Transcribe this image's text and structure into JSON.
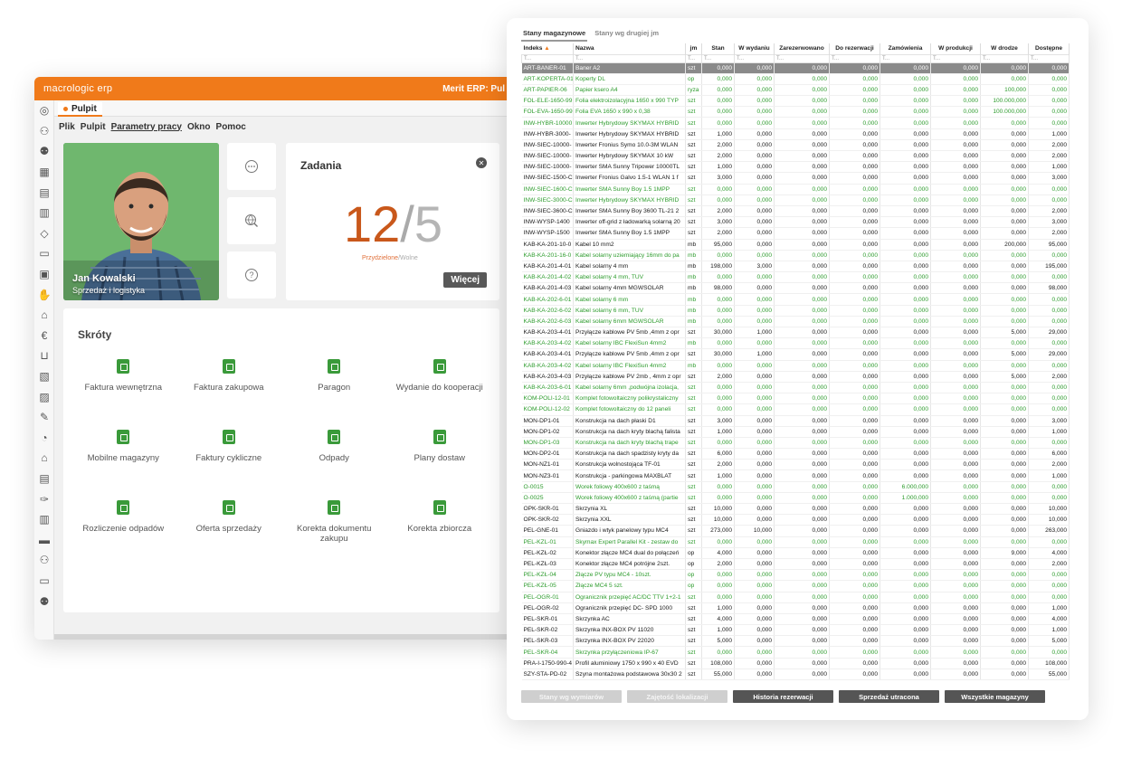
{
  "left_window": {
    "app_name": "macrologic erp",
    "system_title": "Merit ERP: Pul",
    "tab_label": "Pulpit",
    "menu": [
      "Plik",
      "Pulpit",
      "Parametry pracy",
      "Okno",
      "Pomoc"
    ],
    "sidebar_icons": [
      "network-icon",
      "people-icon",
      "user-icon",
      "calculator-grid-icon",
      "document-icon",
      "table-icon",
      "diamond-icon",
      "card-icon",
      "clipboard-icon",
      "handshake-icon",
      "bank-icon",
      "euro-icon",
      "basket-icon",
      "documents-icon",
      "factory-icon",
      "tools-icon",
      "bag-icon",
      "warehouse-icon",
      "invoice-icon",
      "wrench-icon",
      "trash-icon",
      "truck-icon",
      "person-icon",
      "wallet-icon",
      "user-settings-icon"
    ],
    "profile": {
      "name": "Jan Kowalski",
      "role": "Sprzedaż i logistyka"
    },
    "tasks": {
      "title": "Zadania",
      "assigned": "12",
      "separator": "/",
      "free": "5",
      "caption_assigned": "Przydzielone",
      "caption_sep": "/",
      "caption_free": "Wolne",
      "more_label": "Więcej"
    },
    "shortcuts": {
      "title": "Skróty",
      "items": [
        {
          "label": "Faktura wewnętrzna"
        },
        {
          "label": "Faktura zakupowa"
        },
        {
          "label": "Paragon"
        },
        {
          "label": "Wydanie do kooperacji"
        },
        {
          "label": "Mobilne magazyny"
        },
        {
          "label": "Faktury cykliczne"
        },
        {
          "label": "Odpady"
        },
        {
          "label": "Plany dostaw"
        },
        {
          "label": "Rozliczenie odpadów"
        },
        {
          "label": "Oferta sprzedaży"
        },
        {
          "label": "Korekta dokumentu zakupu"
        },
        {
          "label": "Korekta zbiorcza"
        }
      ]
    },
    "accent": "#f07a1a"
  },
  "right_window": {
    "tabs": [
      "Stany magazynowe",
      "Stany wg drugiej jm"
    ],
    "columns": [
      "Indeks",
      "Nazwa",
      "jm",
      "Stan",
      "W wydaniu",
      "Zarezerwowano",
      "Do rezerwacji",
      "Zamówienia",
      "W produkcji",
      "W drodze",
      "Dostępne"
    ],
    "filter_placeholder": "T...",
    "rows": [
      {
        "c": "s",
        "v": [
          "ART-BANER-01",
          "Baner A2",
          "szt",
          "0,000",
          "0,000",
          "0,000",
          "0,000",
          "0,000",
          "0,000",
          "0,000",
          "0,000"
        ]
      },
      {
        "c": "g",
        "v": [
          "ART-KOPERTA-01",
          "Koperty DL",
          "op",
          "0,000",
          "0,000",
          "0,000",
          "0,000",
          "0,000",
          "0,000",
          "0,000",
          "0,000"
        ]
      },
      {
        "c": "g",
        "v": [
          "ART-PAPIER-06",
          "Papier ksero A4",
          "ryza",
          "0,000",
          "0,000",
          "0,000",
          "0,000",
          "0,000",
          "0,000",
          "100,000",
          "0,000"
        ]
      },
      {
        "c": "g",
        "v": [
          "FOL-ELE-1650-99",
          "Folia elektroizolacyjna 1650 x 990  TYP",
          "szt",
          "0,000",
          "0,000",
          "0,000",
          "0,000",
          "0,000",
          "0,000",
          "100.000,000",
          "0,000"
        ]
      },
      {
        "c": "g",
        "v": [
          "FOL-EVA-1650-99",
          "Folia EVA 1650 x 990 x 0,38",
          "szt",
          "0,000",
          "0,000",
          "0,000",
          "0,000",
          "0,000",
          "0,000",
          "100.000,000",
          "0,000"
        ]
      },
      {
        "c": "g",
        "v": [
          "INW-HYBR-10000",
          "Inwerter Hybrydowy SKYMAX HYBRID",
          "szt",
          "0,000",
          "0,000",
          "0,000",
          "0,000",
          "0,000",
          "0,000",
          "0,000",
          "0,000"
        ]
      },
      {
        "c": "b",
        "v": [
          "INW-HYBR-3000-",
          "Inwerter Hybrydowy SKYMAX HYBRID",
          "szt",
          "1,000",
          "0,000",
          "0,000",
          "0,000",
          "0,000",
          "0,000",
          "0,000",
          "1,000"
        ]
      },
      {
        "c": "b",
        "v": [
          "INW-SIEC-10000-",
          "Inwerter Fronius Symo 10.0-3M WLAN",
          "szt",
          "2,000",
          "0,000",
          "0,000",
          "0,000",
          "0,000",
          "0,000",
          "0,000",
          "2,000"
        ]
      },
      {
        "c": "b",
        "v": [
          "INW-SIEC-10000-",
          "Inwerter Hybrydowy SKYMAX 10 kW",
          "szt",
          "2,000",
          "0,000",
          "0,000",
          "0,000",
          "0,000",
          "0,000",
          "0,000",
          "2,000"
        ]
      },
      {
        "c": "b",
        "v": [
          "INW-SIEC-10000-",
          "Inwerter SMA Sunny Tripower 10000TL",
          "szt",
          "1,000",
          "0,000",
          "0,000",
          "0,000",
          "0,000",
          "0,000",
          "0,000",
          "1,000"
        ]
      },
      {
        "c": "b",
        "v": [
          "INW-SIEC-1500-C",
          "Inwerter Fronius Galvo 1.5-1 WLAN 1 f",
          "szt",
          "3,000",
          "0,000",
          "0,000",
          "0,000",
          "0,000",
          "0,000",
          "0,000",
          "3,000"
        ]
      },
      {
        "c": "g",
        "v": [
          "INW-SIEC-1600-C",
          "Inwerter SMA Sunny Boy 1.5 1MPP",
          "szt",
          "0,000",
          "0,000",
          "0,000",
          "0,000",
          "0,000",
          "0,000",
          "0,000",
          "0,000"
        ]
      },
      {
        "c": "g",
        "v": [
          "INW-SIEC-3000-C",
          "Inwerter Hybrydowy SKYMAX HYBRID",
          "szt",
          "0,000",
          "0,000",
          "0,000",
          "0,000",
          "0,000",
          "0,000",
          "0,000",
          "0,000"
        ]
      },
      {
        "c": "b",
        "v": [
          "INW-SIEC-3600-C",
          "Inwerter SMA Sunny Boy 3600 TL-21 2",
          "szt",
          "2,000",
          "0,000",
          "0,000",
          "0,000",
          "0,000",
          "0,000",
          "0,000",
          "2,000"
        ]
      },
      {
        "c": "b",
        "v": [
          "INW-WYSP-1400",
          "Inwerter off-grid z ładowarką solarną 20",
          "szt",
          "3,000",
          "0,000",
          "0,000",
          "0,000",
          "0,000",
          "0,000",
          "0,000",
          "3,000"
        ]
      },
      {
        "c": "b",
        "v": [
          "INW-WYSP-1500",
          "Inwerter SMA Sunny Boy 1.5 1MPP",
          "szt",
          "2,000",
          "0,000",
          "0,000",
          "0,000",
          "0,000",
          "0,000",
          "0,000",
          "2,000"
        ]
      },
      {
        "c": "b",
        "v": [
          "KAB-KA-201-10-0",
          "Kabel 10 mm2",
          "mb",
          "95,000",
          "0,000",
          "0,000",
          "0,000",
          "0,000",
          "0,000",
          "200,000",
          "95,000"
        ]
      },
      {
        "c": "g",
        "v": [
          "KAB-KA-201-16-0",
          "Kabel solarny uziemiający 16mm do pa",
          "mb",
          "0,000",
          "0,000",
          "0,000",
          "0,000",
          "0,000",
          "0,000",
          "0,000",
          "0,000"
        ]
      },
      {
        "c": "b",
        "v": [
          "KAB-KA-201-4-01",
          "Kabel solarny 4 mm",
          "mb",
          "198,000",
          "3,000",
          "0,000",
          "0,000",
          "0,000",
          "0,000",
          "0,000",
          "195,000"
        ]
      },
      {
        "c": "g",
        "v": [
          "KAB-KA-201-4-02",
          "Kabel solarny 4 mm, TUV",
          "mb",
          "0,000",
          "0,000",
          "0,000",
          "0,000",
          "0,000",
          "0,000",
          "0,000",
          "0,000"
        ]
      },
      {
        "c": "b",
        "v": [
          "KAB-KA-201-4-03",
          "Kabel solarny 4mm MGWSOLAR",
          "mb",
          "98,000",
          "0,000",
          "0,000",
          "0,000",
          "0,000",
          "0,000",
          "0,000",
          "98,000"
        ]
      },
      {
        "c": "g",
        "v": [
          "KAB-KA-202-6-01",
          "Kabel solarny 6 mm",
          "mb",
          "0,000",
          "0,000",
          "0,000",
          "0,000",
          "0,000",
          "0,000",
          "0,000",
          "0,000"
        ]
      },
      {
        "c": "g",
        "v": [
          "KAB-KA-202-6-02",
          "Kabel solarny 6 mm, TUV",
          "mb",
          "0,000",
          "0,000",
          "0,000",
          "0,000",
          "0,000",
          "0,000",
          "0,000",
          "0,000"
        ]
      },
      {
        "c": "g",
        "v": [
          "KAB-KA-202-6-03",
          "Kabel solarny 6mm MGWSOLAR",
          "mb",
          "0,000",
          "0,000",
          "0,000",
          "0,000",
          "0,000",
          "0,000",
          "0,000",
          "0,000"
        ]
      },
      {
        "c": "b",
        "v": [
          "KAB-KA-203-4-01",
          "Przyłącze kablowe PV 5mb ,4mm z opr",
          "szt",
          "30,000",
          "1,000",
          "0,000",
          "0,000",
          "0,000",
          "0,000",
          "5,000",
          "29,000"
        ]
      },
      {
        "c": "g",
        "v": [
          "KAB-KA-203-4-02",
          "Kabel solarny IBC FlexiSun 4mm2",
          "mb",
          "0,000",
          "0,000",
          "0,000",
          "0,000",
          "0,000",
          "0,000",
          "0,000",
          "0,000"
        ]
      },
      {
        "c": "b",
        "v": [
          "KAB-KA-203-4-01",
          "Przyłącze kablowe PV 5mb ,4mm z opr",
          "szt",
          "30,000",
          "1,000",
          "0,000",
          "0,000",
          "0,000",
          "0,000",
          "5,000",
          "29,000"
        ]
      },
      {
        "c": "g",
        "v": [
          "KAB-KA-203-4-02",
          "Kabel solarny IBC FlexiSun 4mm2",
          "mb",
          "0,000",
          "0,000",
          "0,000",
          "0,000",
          "0,000",
          "0,000",
          "0,000",
          "0,000"
        ]
      },
      {
        "c": "b",
        "v": [
          "KAB-KA-203-4-03",
          "Przyłącze kablowe PV 2mb , 4mm z opr",
          "szt",
          "2,000",
          "0,000",
          "0,000",
          "0,000",
          "0,000",
          "0,000",
          "5,000",
          "2,000"
        ]
      },
      {
        "c": "g",
        "v": [
          "KAB-KA-203-6-01",
          "Kabel solarny 6mm ,podwójna izolacja,",
          "szt",
          "0,000",
          "0,000",
          "0,000",
          "0,000",
          "0,000",
          "0,000",
          "0,000",
          "0,000"
        ]
      },
      {
        "c": "g",
        "v": [
          "KOM-POLI-12-01",
          "Komplet fotowoltaiczny polikrystaliczny",
          "szt",
          "0,000",
          "0,000",
          "0,000",
          "0,000",
          "0,000",
          "0,000",
          "0,000",
          "0,000"
        ]
      },
      {
        "c": "g",
        "v": [
          "KOM-POLI-12-02",
          "Komplet fotowoltaiczny do 12 paneli",
          "szt",
          "0,000",
          "0,000",
          "0,000",
          "0,000",
          "0,000",
          "0,000",
          "0,000",
          "0,000"
        ]
      },
      {
        "c": "b",
        "v": [
          "MON-DP1-01",
          "Konstrukcja na dach płaski D1",
          "szt",
          "3,000",
          "0,000",
          "0,000",
          "0,000",
          "0,000",
          "0,000",
          "0,000",
          "3,000"
        ]
      },
      {
        "c": "b",
        "v": [
          "MON-DP1-02",
          "Konstrukcja na dach kryty blachą falista",
          "szt",
          "1,000",
          "0,000",
          "0,000",
          "0,000",
          "0,000",
          "0,000",
          "0,000",
          "1,000"
        ]
      },
      {
        "c": "g",
        "v": [
          "MON-DP1-03",
          "Konstrukcja na dach kryty blachą trape",
          "szt",
          "0,000",
          "0,000",
          "0,000",
          "0,000",
          "0,000",
          "0,000",
          "0,000",
          "0,000"
        ]
      },
      {
        "c": "b",
        "v": [
          "MON-DP2-01",
          "Konstrukcja na dach spadzisty kryty da",
          "szt",
          "6,000",
          "0,000",
          "0,000",
          "0,000",
          "0,000",
          "0,000",
          "0,000",
          "6,000"
        ]
      },
      {
        "c": "b",
        "v": [
          "MON-NZ1-01",
          "Konstrukcja wolnostojąca TF-01",
          "szt",
          "2,000",
          "0,000",
          "0,000",
          "0,000",
          "0,000",
          "0,000",
          "0,000",
          "2,000"
        ]
      },
      {
        "c": "b",
        "v": [
          "MON-NZ3-01",
          "Konstrukcja - parkingowa MAXBLAT",
          "szt",
          "1,000",
          "0,000",
          "0,000",
          "0,000",
          "0,000",
          "0,000",
          "0,000",
          "1,000"
        ]
      },
      {
        "c": "g",
        "v": [
          "O-0015",
          "Worek foliowy 400x600 z taśmą",
          "szt",
          "0,000",
          "0,000",
          "0,000",
          "0,000",
          "6.000,000",
          "0,000",
          "0,000",
          "0,000"
        ]
      },
      {
        "c": "g",
        "v": [
          "O-0025",
          "Worek foliowy 400x600 z taśmą (partie",
          "szt",
          "0,000",
          "0,000",
          "0,000",
          "0,000",
          "1.000,000",
          "0,000",
          "0,000",
          "0,000"
        ]
      },
      {
        "c": "b",
        "v": [
          "OPK-SKR-01",
          "Skrzynia XL",
          "szt",
          "10,000",
          "0,000",
          "0,000",
          "0,000",
          "0,000",
          "0,000",
          "0,000",
          "10,000"
        ]
      },
      {
        "c": "b",
        "v": [
          "OPK-SKR-02",
          "Skrzynia XXL",
          "szt",
          "10,000",
          "0,000",
          "0,000",
          "0,000",
          "0,000",
          "0,000",
          "0,000",
          "10,000"
        ]
      },
      {
        "c": "b",
        "v": [
          "PEL-GNE-01",
          "Gniazdo i wtyk panelowy typu MC4",
          "szt",
          "273,000",
          "10,000",
          "0,000",
          "0,000",
          "0,000",
          "0,000",
          "0,000",
          "263,000"
        ]
      },
      {
        "c": "g",
        "v": [
          "PEL-KZL-01",
          "Skymax Expert Parallel Kit - zestaw  do",
          "szt",
          "0,000",
          "0,000",
          "0,000",
          "0,000",
          "0,000",
          "0,000",
          "0,000",
          "0,000"
        ]
      },
      {
        "c": "b",
        "v": [
          "PEL-KZŁ-02",
          "Konektor złącze MC4 dual do połączeń",
          "op",
          "4,000",
          "0,000",
          "0,000",
          "0,000",
          "0,000",
          "0,000",
          "9,000",
          "4,000"
        ]
      },
      {
        "c": "b",
        "v": [
          "PEL-KZŁ-03",
          "Konektor złącze MC4 potrójne 2szt.",
          "op",
          "2,000",
          "0,000",
          "0,000",
          "0,000",
          "0,000",
          "0,000",
          "0,000",
          "2,000"
        ]
      },
      {
        "c": "g",
        "v": [
          "PEL-KZŁ-04",
          "Złącze PV typu MC4 - 10szt.",
          "op",
          "0,000",
          "0,000",
          "0,000",
          "0,000",
          "0,000",
          "0,000",
          "0,000",
          "0,000"
        ]
      },
      {
        "c": "g",
        "v": [
          "PEL-KZŁ-05",
          "Złącze MC4 5 szt.",
          "op",
          "0,000",
          "0,000",
          "0,000",
          "0,000",
          "0,000",
          "0,000",
          "0,000",
          "0,000"
        ]
      },
      {
        "c": "g",
        "v": [
          "PEL-OGR-01",
          "Ogranicznik przepięć AC/DC TTV 1+2-1",
          "szt",
          "0,000",
          "0,000",
          "0,000",
          "0,000",
          "0,000",
          "0,000",
          "0,000",
          "0,000"
        ]
      },
      {
        "c": "b",
        "v": [
          "PEL-OGR-02",
          "Ogranicznik przepięć DC- SPD 1000",
          "szt",
          "1,000",
          "0,000",
          "0,000",
          "0,000",
          "0,000",
          "0,000",
          "0,000",
          "1,000"
        ]
      },
      {
        "c": "b",
        "v": [
          "PEL-SKR-01",
          "Skrzynka AC",
          "szt",
          "4,000",
          "0,000",
          "0,000",
          "0,000",
          "0,000",
          "0,000",
          "0,000",
          "4,000"
        ]
      },
      {
        "c": "b",
        "v": [
          "PEL-SKR-02",
          "Skrzynka INX-BOX PV 11020",
          "szt",
          "1,000",
          "0,000",
          "0,000",
          "0,000",
          "0,000",
          "0,000",
          "0,000",
          "1,000"
        ]
      },
      {
        "c": "b",
        "v": [
          "PEL-SKR-03",
          "Skrzynka INX-BOX PV 22020",
          "szt",
          "5,000",
          "0,000",
          "0,000",
          "0,000",
          "0,000",
          "0,000",
          "0,000",
          "5,000"
        ]
      },
      {
        "c": "g",
        "v": [
          "PEL-SKR-04",
          "Skrzynka przyłączeniowa IP-67",
          "szt",
          "0,000",
          "0,000",
          "0,000",
          "0,000",
          "0,000",
          "0,000",
          "0,000",
          "0,000"
        ]
      },
      {
        "c": "b",
        "v": [
          "PRA-I-1750-990-4",
          "Profil aluminiowy 1750 x 990 x 40 EVD",
          "szt",
          "108,000",
          "0,000",
          "0,000",
          "0,000",
          "0,000",
          "0,000",
          "0,000",
          "108,000"
        ]
      },
      {
        "c": "b",
        "v": [
          "SZY-STA-PD-02",
          "Szyna montażowa podstawowa 30x30 2",
          "szt",
          "55,000",
          "0,000",
          "0,000",
          "0,000",
          "0,000",
          "0,000",
          "0,000",
          "55,000"
        ]
      }
    ],
    "buttons": [
      {
        "label": "Stany wg wymiarów",
        "enabled": false
      },
      {
        "label": "Zajętość lokalizacji",
        "enabled": false
      },
      {
        "label": "Historia rezerwacji",
        "enabled": true
      },
      {
        "label": "Sprzedaż utracona",
        "enabled": true
      },
      {
        "label": "Wszystkie magazyny",
        "enabled": true
      }
    ],
    "row_colors": {
      "green": "#2e9c2e",
      "black": "#1a1a1a",
      "selected_bg": "#8a8a8a"
    }
  }
}
